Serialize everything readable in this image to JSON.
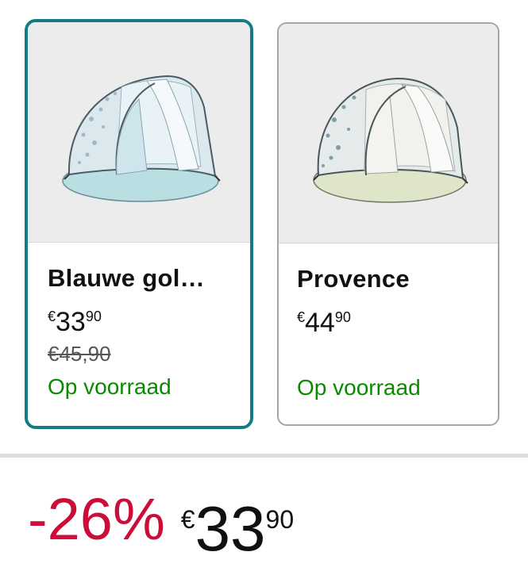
{
  "variants": [
    {
      "title": "Blauwe gol…",
      "image_label": "tent-image",
      "price": {
        "currency": "€",
        "whole": "33",
        "fraction": "90"
      },
      "was_price": "€45,90",
      "stock": "Op voorraad",
      "selected": true
    },
    {
      "title": "Provence",
      "image_label": "tent-image",
      "price": {
        "currency": "€",
        "whole": "44",
        "fraction": "90"
      },
      "stock": "Op voorraad",
      "selected": false
    }
  ],
  "summary": {
    "discount": "-26%",
    "price": {
      "currency": "€",
      "whole": "33",
      "fraction": "90"
    }
  },
  "colors": {
    "selected_border": "#127c86",
    "card_border": "#a5a5a5",
    "stock_green": "#0a8a00",
    "discount_red": "#cc0c39"
  }
}
